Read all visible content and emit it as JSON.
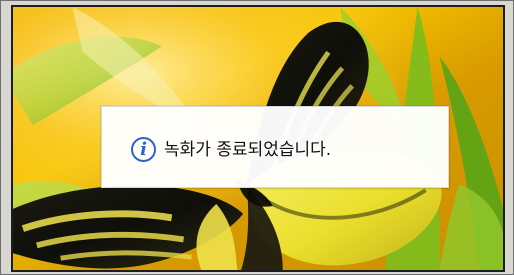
{
  "notification": {
    "icon": "info-icon",
    "icon_glyph": "i",
    "message": "녹화가 종료되었습니다."
  },
  "colors": {
    "info_icon": "#2d64c8",
    "background_accent": "#d9a000"
  }
}
